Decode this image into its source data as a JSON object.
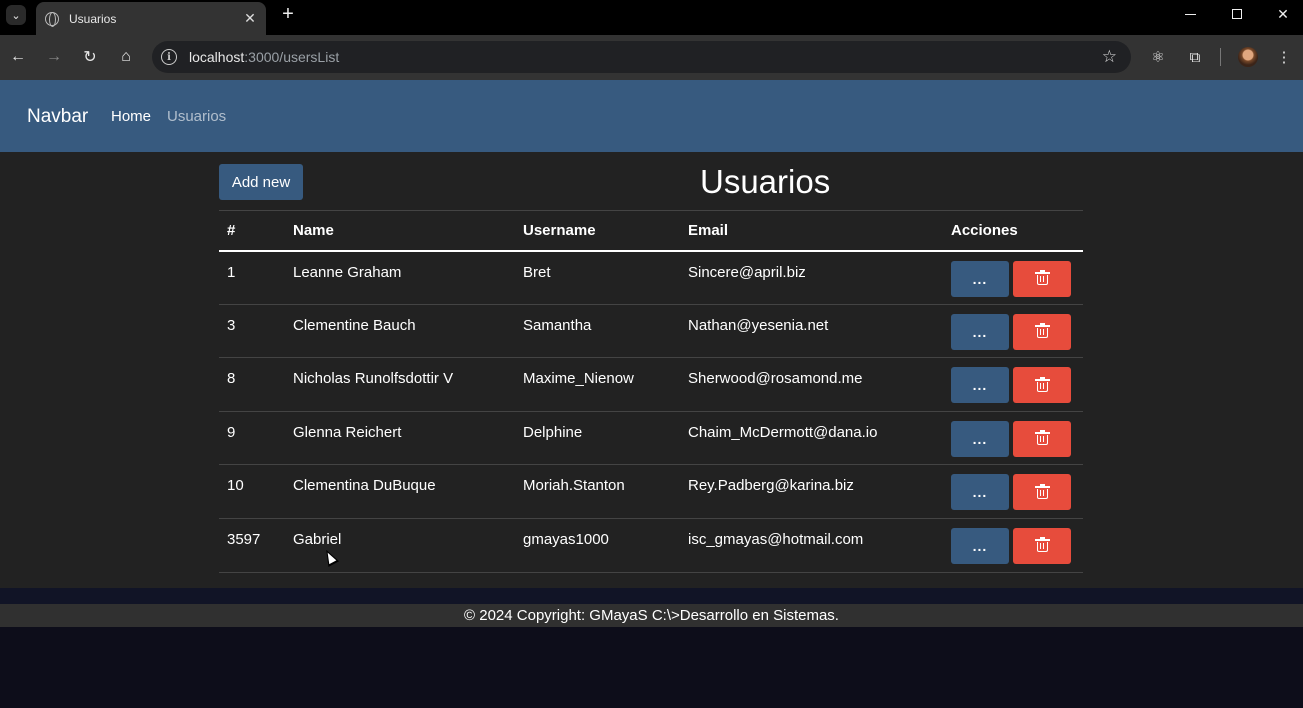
{
  "browser": {
    "tab_title": "Usuarios",
    "url_host": "localhost",
    "url_path": ":3000/usersList",
    "icons": [
      "tab-search-icon",
      "globe-icon",
      "close-icon",
      "plus-icon",
      "back-icon",
      "forward-icon",
      "reload-icon",
      "home-icon",
      "info-icon",
      "star-icon",
      "react-icon",
      "puzzle-icon",
      "avatar",
      "menu-icon"
    ]
  },
  "navbar": {
    "brand": "Navbar",
    "links": [
      {
        "label": "Home"
      },
      {
        "label": "Usuarios"
      }
    ]
  },
  "main": {
    "add_label": "Add new",
    "title": "Usuarios",
    "columns": [
      "#",
      "Name",
      "Username",
      "Email",
      "Acciones"
    ],
    "view_label": "...",
    "rows": [
      {
        "id": "1",
        "name": "Leanne Graham",
        "username": "Bret",
        "email": "Sincere@april.biz"
      },
      {
        "id": "3",
        "name": "Clementine Bauch",
        "username": "Samantha",
        "email": "Nathan@yesenia.net"
      },
      {
        "id": "8",
        "name": "Nicholas Runolfsdottir V",
        "username": "Maxime_Nienow",
        "email": "Sherwood@rosamond.me"
      },
      {
        "id": "9",
        "name": "Glenna Reichert",
        "username": "Delphine",
        "email": "Chaim_McDermott@dana.io"
      },
      {
        "id": "10",
        "name": "Clementina DuBuque",
        "username": "Moriah.Stanton",
        "email": "Rey.Padberg@karina.biz"
      },
      {
        "id": "3597",
        "name": "Gabriel",
        "username": "gmayas1000",
        "email": "isc_gmayas@hotmail.com"
      }
    ]
  },
  "footer": {
    "text": "© 2024 Copyright: GMayaS C:\\>Desarrollo en Sistemas."
  },
  "colors": {
    "primary": "#375a7f",
    "danger": "#e74c3c",
    "background": "#222222"
  }
}
